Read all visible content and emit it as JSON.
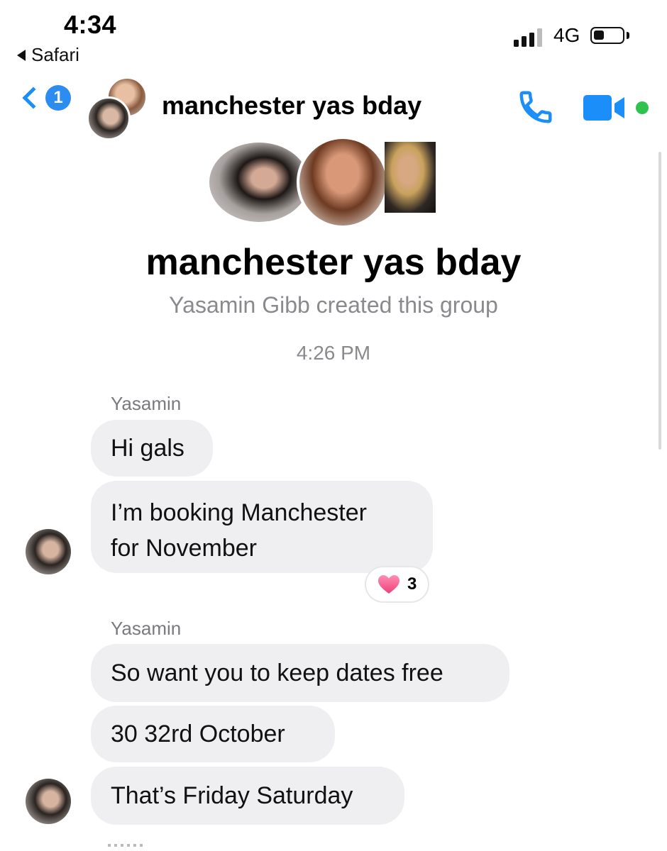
{
  "status_bar": {
    "time": "4:34",
    "back_app": "Safari",
    "network": "4G"
  },
  "header": {
    "unread_count": "1",
    "title": "manchester yas bday",
    "accent_color": "#1c8ef9",
    "online_color": "#31c24e",
    "icons": [
      "chevron-left-icon",
      "phone-icon",
      "video-camera-icon"
    ]
  },
  "group_info": {
    "name": "manchester yas bday",
    "created_text": "Yasamin Gibb created this group"
  },
  "thread": {
    "timestamp": "4:26 PM",
    "groups": [
      {
        "sender": "Yasamin",
        "messages": [
          "Hi gals",
          "I’m booking Manchester",
          "for November"
        ],
        "reaction": {
          "icon": "heart-icon",
          "count": "3"
        }
      },
      {
        "sender": "Yasamin",
        "messages": [
          "So want you to keep dates free",
          "30 32rd October",
          "That’s Friday Saturday"
        ]
      }
    ]
  }
}
